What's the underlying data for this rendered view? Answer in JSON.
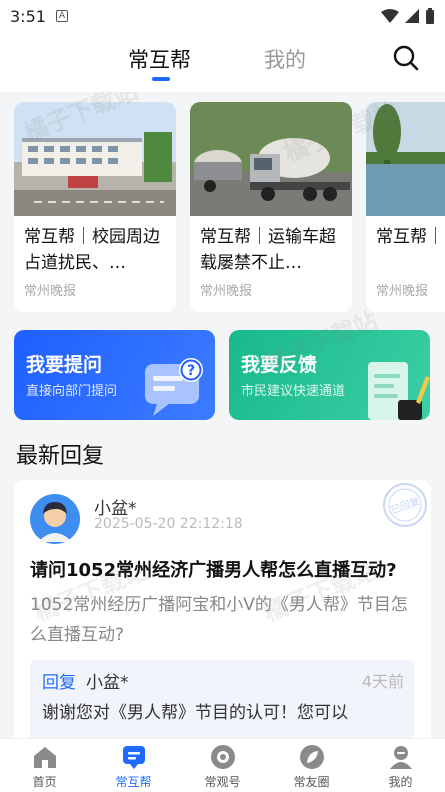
{
  "status": {
    "time": "3:51",
    "notif_icon": "A"
  },
  "top_nav": {
    "tabs": [
      "常互帮",
      "我的"
    ],
    "active_tab": 0
  },
  "news": [
    {
      "title": "常互帮｜校园周边占道扰民、…",
      "source": "常州晚报"
    },
    {
      "title": "常互帮｜运输车超载屡禁不止…",
      "source": "常州晚报"
    },
    {
      "title": "常互帮｜闭致出行",
      "source": "常州晚报"
    }
  ],
  "actions": [
    {
      "title": "我要提问",
      "subtitle": "直接向部门提问"
    },
    {
      "title": "我要反馈",
      "subtitle": "市民建议快速通道"
    }
  ],
  "section_title": "最新回复",
  "reply": {
    "user": "小盆*",
    "time": "2025-05-20 22:12:18",
    "stamp": "已回复",
    "question_title": "请问1052常州经济广播男人帮怎么直播互动?",
    "question_body": "1052常州经历广播阿宝和小V的《男人帮》节目怎么直播互动?",
    "answer_label": "回复",
    "answer_user": "小盆*",
    "answer_ago": "4天前",
    "answer_text": "谢谢您对《男人帮》节目的认可！您可以"
  },
  "watermark": "橘子下载站",
  "bottom_nav": [
    "首页",
    "常互帮",
    "常观号",
    "常友圈",
    "我的"
  ],
  "colors": {
    "primary": "#1e6bff",
    "green": "#18b98d",
    "bg": "#f4f5f7"
  }
}
